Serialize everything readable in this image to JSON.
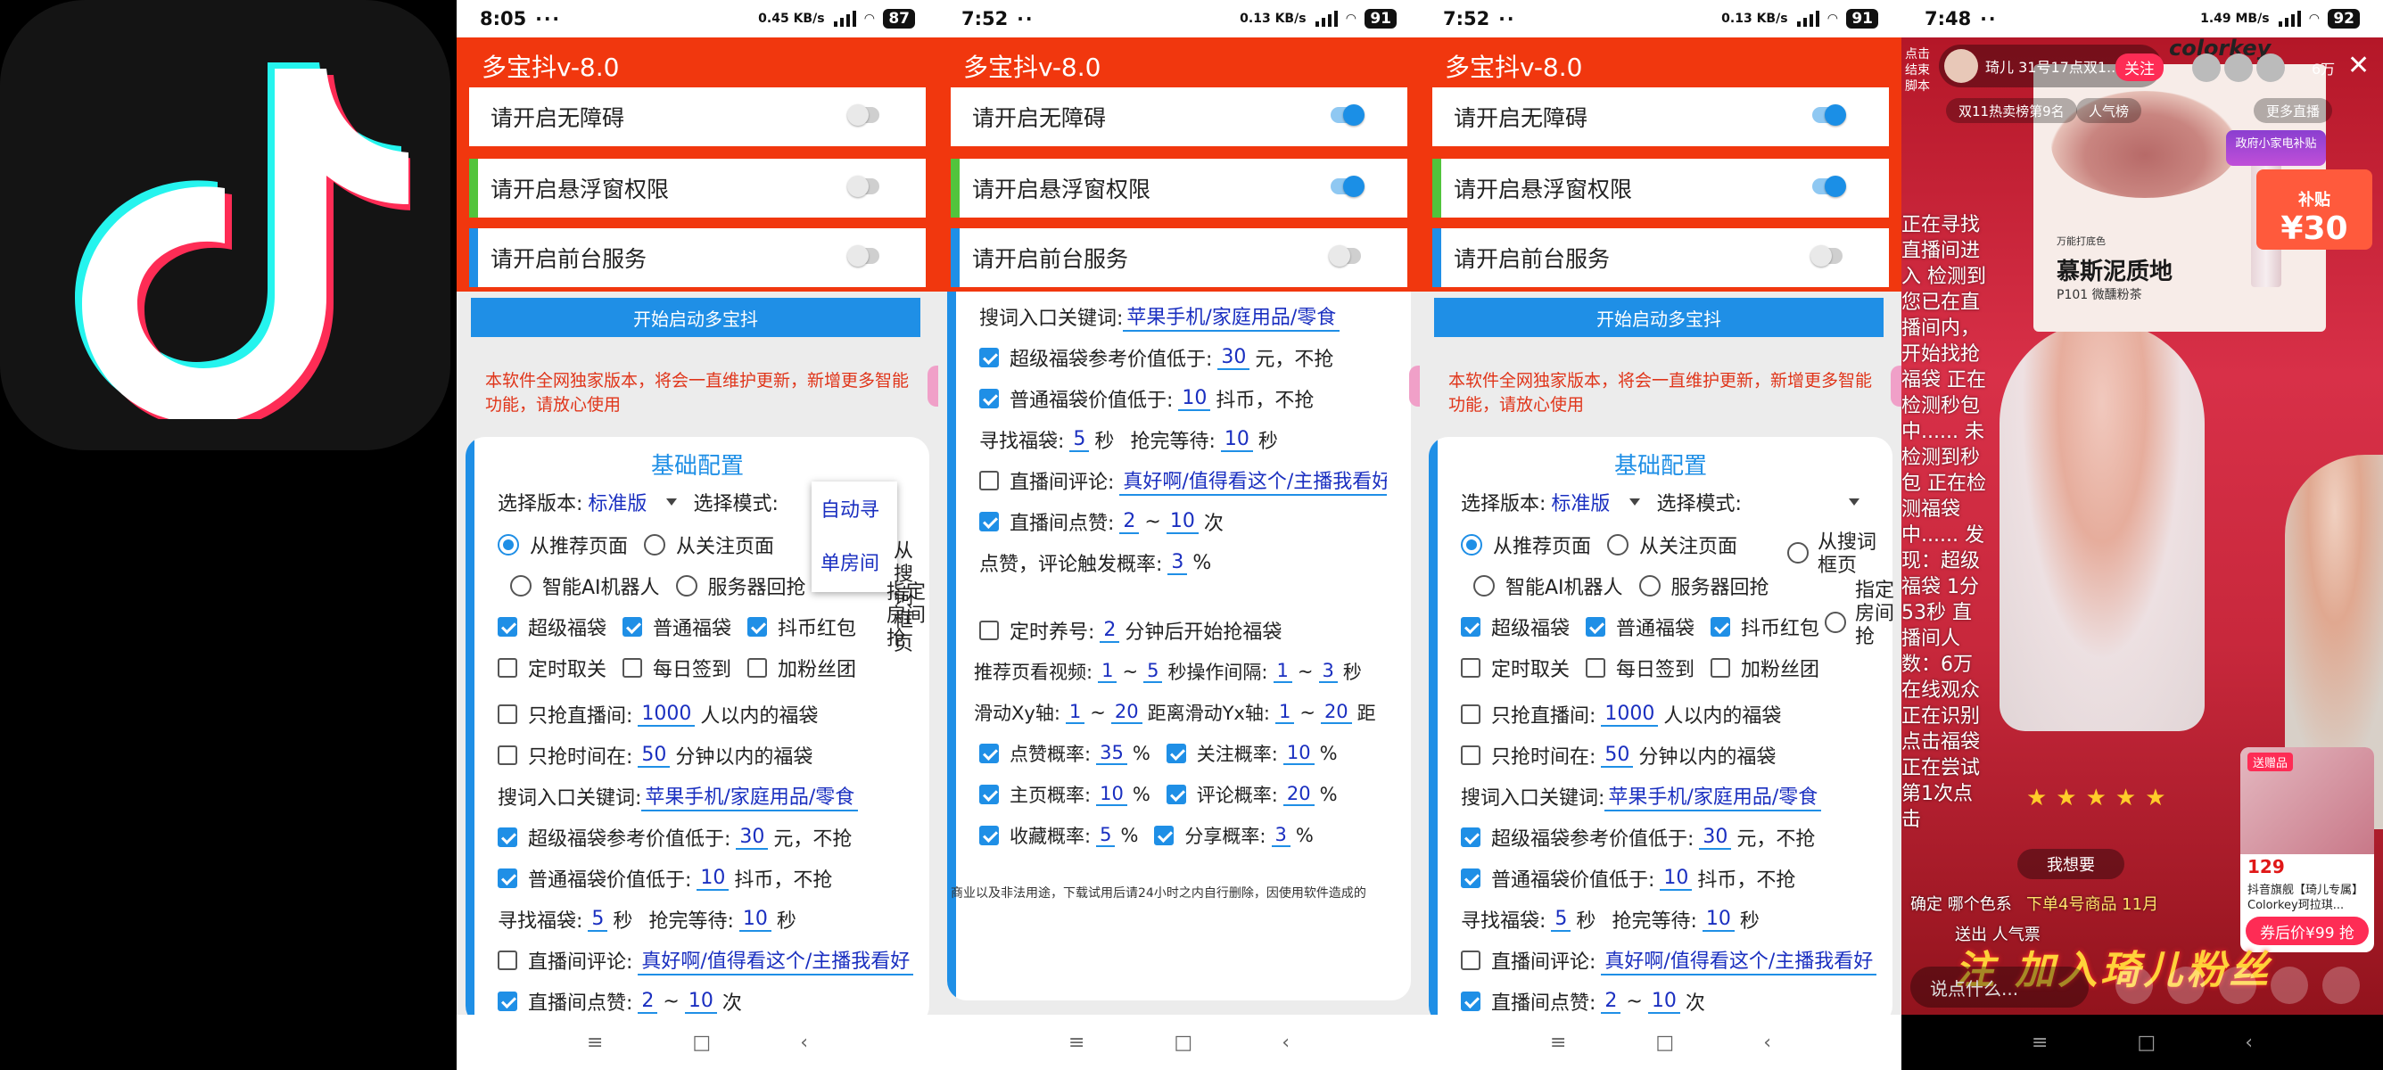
{
  "logo": {
    "name": "tiktok-logo",
    "colors": {
      "cyan": "#25f4ee",
      "red": "#fe2c55",
      "white": "#ffffff",
      "bg": "#141414"
    }
  },
  "phones": [
    {
      "status": {
        "time": "8:05",
        "dots": "···",
        "speed": "0.45 KB/s",
        "battery": "87"
      },
      "title": "多宝抖v-8.0",
      "perms": [
        {
          "label": "请开启无障碍",
          "bar": "",
          "on": false
        },
        {
          "label": "请开启悬浮窗权限",
          "bar": "#52c43c",
          "on": false
        },
        {
          "label": "请开启前台服务",
          "bar": "#1f8fe6",
          "on": false
        }
      ],
      "start_button": "开始启动多宝抖",
      "notice": "本软件全网独家版本，将会一直维护更新，新增更多智能功能，请放心使用",
      "card_title": "基础配置",
      "select_version_label": "选择版本:",
      "select_version_value": "标准版",
      "select_mode_label": "选择模式:",
      "dropdown": [
        "自动寻",
        "单房间"
      ],
      "radio_1": [
        "从推荐页面",
        "从关注页面",
        "从搜词框页"
      ],
      "radio_2": [
        "智能AI机器人",
        "服务器回抢",
        "指定房间抢"
      ],
      "checks_1": [
        "超级福袋",
        "普通福袋",
        "抖币红包"
      ],
      "checks_2": [
        "定时取关",
        "每日签到",
        "加粉丝团"
      ],
      "only_live_label": "只抢直播间:",
      "only_live_value": "1000",
      "only_live_suffix": "人以内的福袋",
      "only_time_label": "只抢时间在:",
      "only_time_value": "50",
      "only_time_suffix": "分钟以内的福袋",
      "keyword_label": "搜词入口关键词:",
      "keyword_value": "苹果手机/家庭用品/零食",
      "super_ref_label": "超级福袋参考价值低于:",
      "super_ref_value": "30",
      "super_ref_suffix": "元，不抢",
      "normal_ref_label": "普通福袋价值低于:",
      "normal_ref_value": "10",
      "normal_ref_suffix": "抖币，不抢",
      "find_label": "寻找福袋:",
      "find_value": "5",
      "sec": "秒",
      "wait_label": "抢完等待:",
      "wait_value": "10",
      "comment_label": "直播间评论:",
      "comment_value": "真好啊/值得看这个/主播我看好",
      "like_label": "直播间点赞:",
      "like_from": "2",
      "like_to": "10",
      "times": "次"
    },
    {
      "status": {
        "time": "7:52",
        "dots": "··",
        "speed": "0.13 KB/s",
        "battery": "91"
      },
      "title": "多宝抖v-8.0",
      "perms": [
        {
          "label": "请开启无障碍",
          "bar": "",
          "on": true
        },
        {
          "label": "请开启悬浮窗权限",
          "bar": "#52c43c",
          "on": true
        },
        {
          "label": "请开启前台服务",
          "bar": "#1f8fe6",
          "on": false
        }
      ],
      "keyword_label": "搜词入口关键词:",
      "keyword_value": "苹果手机/家庭用品/零食",
      "super_ref_label": "超级福袋参考价值低于:",
      "super_ref_value": "30",
      "super_ref_suffix": "元，不抢",
      "normal_ref_label": "普通福袋价值低于:",
      "normal_ref_value": "10",
      "normal_ref_suffix": "抖币，不抢",
      "find_label": "寻找福袋:",
      "find_value": "5",
      "sec": "秒",
      "wait_label": "抢完等待:",
      "wait_value": "10",
      "comment_label": "直播间评论:",
      "comment_value": "真好啊/值得看这个/主播我看好",
      "like_label": "直播间点赞:",
      "like_from": "2",
      "like_to": "10",
      "times": "次",
      "trigger_label": "点赞，评论触发概率:",
      "trigger_value": "3",
      "pct": "%",
      "nurture_label": "定时养号:",
      "nurture_value": "2",
      "nurture_suffix": "分钟后开始抢福袋",
      "rec_label": "推荐页看视频:",
      "rec_from": "1",
      "rec_to": "5",
      "rec_suffix": "秒",
      "op_label": "操作间隔:",
      "op_from": "1",
      "op_to": "3",
      "op_suffix": "秒",
      "xy_label": "滑动Xy轴:",
      "xy_from": "1",
      "xy_to": "20",
      "xy_suffix": "距离",
      "yx_label": "滑动Yx轴:",
      "yx_from": "1",
      "yx_to": "20",
      "yx_suffix": "距",
      "probs": [
        {
          "label": "点赞概率:",
          "value": "35"
        },
        {
          "label": "关注概率:",
          "value": "10"
        },
        {
          "label": "主页概率:",
          "value": "10"
        },
        {
          "label": "评论概率:",
          "value": "20"
        },
        {
          "label": "收藏概率:",
          "value": "5"
        },
        {
          "label": "分享概率:",
          "value": "3"
        }
      ],
      "disclaimer": "商业以及非法用途，下载试用后请24小时之内自行删除，因使用软件造成的"
    },
    {
      "status": {
        "time": "7:52",
        "dots": "··",
        "speed": "0.13 KB/s",
        "battery": "91"
      },
      "title": "多宝抖v-8.0",
      "perms": [
        {
          "label": "请开启无障碍",
          "bar": "",
          "on": true
        },
        {
          "label": "请开启悬浮窗权限",
          "bar": "#52c43c",
          "on": true
        },
        {
          "label": "请开启前台服务",
          "bar": "#1f8fe6",
          "on": false
        }
      ],
      "start_button": "开始启动多宝抖",
      "notice": "本软件全网独家版本，将会一直维护更新，新增更多智能功能，请放心使用",
      "card_title": "基础配置",
      "select_version_label": "选择版本:",
      "select_version_value": "标准版",
      "select_mode_label": "选择模式:",
      "radio_1": [
        "从推荐页面",
        "从关注页面",
        "从搜词框页"
      ],
      "radio_2": [
        "智能AI机器人",
        "服务器回抢",
        "指定房间抢"
      ],
      "checks_1": [
        "超级福袋",
        "普通福袋",
        "抖币红包"
      ],
      "checks_2": [
        "定时取关",
        "每日签到",
        "加粉丝团"
      ],
      "only_live_label": "只抢直播间:",
      "only_live_value": "1000",
      "only_live_suffix": "人以内的福袋",
      "only_time_label": "只抢时间在:",
      "only_time_value": "50",
      "only_time_suffix": "分钟以内的福袋",
      "keyword_label": "搜词入口关键词:",
      "keyword_value": "苹果手机/家庭用品/零食",
      "super_ref_label": "超级福袋参考价值低于:",
      "super_ref_value": "30",
      "super_ref_suffix": "元，不抢",
      "normal_ref_label": "普通福袋价值低于:",
      "normal_ref_value": "10",
      "normal_ref_suffix": "抖币，不抢",
      "find_label": "寻找福袋:",
      "find_value": "5",
      "sec": "秒",
      "wait_label": "抢完等待:",
      "wait_value": "10",
      "comment_label": "直播间评论:",
      "comment_value": "真好啊/值得看这个/主播我看好",
      "like_label": "直播间点赞:",
      "like_from": "2",
      "like_to": "10",
      "times": "次"
    }
  ],
  "live": {
    "status": {
      "time": "7:48",
      "dots": "··",
      "speed": "1.49 MB/s",
      "battery": "92"
    },
    "click_stop": "点击结束脚本",
    "host_name": "琦儿",
    "host_sub": "31号17点双1...",
    "follow": "关注",
    "viewers": "6万",
    "brand": "colorkey",
    "chip_rank": "双11热卖榜第9名",
    "chip_pop": "人气榜",
    "chip_more": "更多直播",
    "product_small": "万能打底色",
    "product_title": "慕斯泥质地",
    "product_code": "P101 微醺粉茶",
    "promo": "政府小家电补贴",
    "subsidy_label": "补贴",
    "subsidy_value": "¥30",
    "log": "正在寻找直播间进入 检测到您已在直播间内，开始找抢福袋 正在检测秒包中...... 未检测到秒包 正在检测福袋中...... 发现：超级福袋 1分53秒 直播间人数：6万在线观众 正在识别点击福袋 正在尝试第1次点击",
    "want": "我想要",
    "line1": "确定 哪个色系",
    "line2": "下单4号商品 11月",
    "line3": "送出 人气票",
    "banner": "注 加入琦儿粉丝",
    "comment_placeholder": "说点什么...",
    "card_tag": "送赠品",
    "card_price": "129",
    "card_name": "抖音旗舰【琦儿专属】Colorkey珂拉琪...",
    "card_buy": "券后价¥99 抢"
  }
}
